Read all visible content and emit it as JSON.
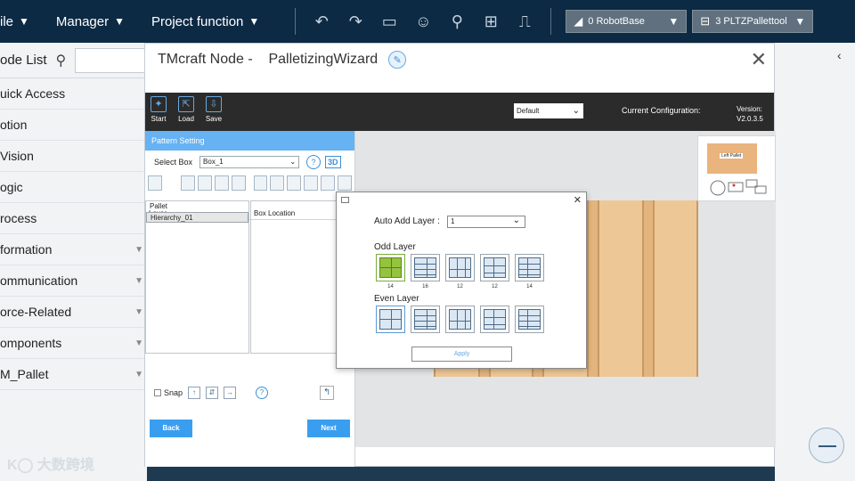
{
  "topbar": {
    "menus": [
      "ile",
      "Manager",
      "Project function"
    ],
    "base_dropdown": "0 RobotBase",
    "tool_dropdown": "3 PLTZPallettool"
  },
  "sidebar": {
    "node_list_label": "ode List",
    "items": [
      "uick Access",
      "otion",
      "Vision",
      "ogic",
      "rocess",
      "formation",
      "ommunication",
      "orce-Related",
      "omponents",
      "M_Pallet"
    ]
  },
  "dialog": {
    "title": "TMcraft Node -    PalletizingWizard",
    "toolbar": {
      "start_label": "Start",
      "load_label": "Load",
      "save_label": "Save",
      "config_select": "Default",
      "current_config_label": "Current Configuration:",
      "version_label": "Version:",
      "version_value": "V2.0.3.5"
    },
    "pattern_setting_label": "Pattern Setting",
    "select_box_label": "Select Box",
    "select_box_value": "Box_1",
    "three_d_label": "3D",
    "layer_col": "Layer",
    "box_location_col": "Box Location",
    "layers": [
      "Pallet",
      "Hierarchy_01"
    ],
    "snap_label": "Snap",
    "back_label": "Back",
    "next_label": "Next",
    "thumbnail_label": "Left Pallet"
  },
  "popup": {
    "auto_add_layer_label": "Auto Add Layer :",
    "auto_add_layer_value": "1",
    "odd_layer_label": "Odd Layer",
    "even_layer_label": "Even Layer",
    "odd_counts": [
      "14",
      "16",
      "12",
      "12",
      "14"
    ],
    "apply_label": "Apply"
  },
  "watermark": "大数跨境"
}
